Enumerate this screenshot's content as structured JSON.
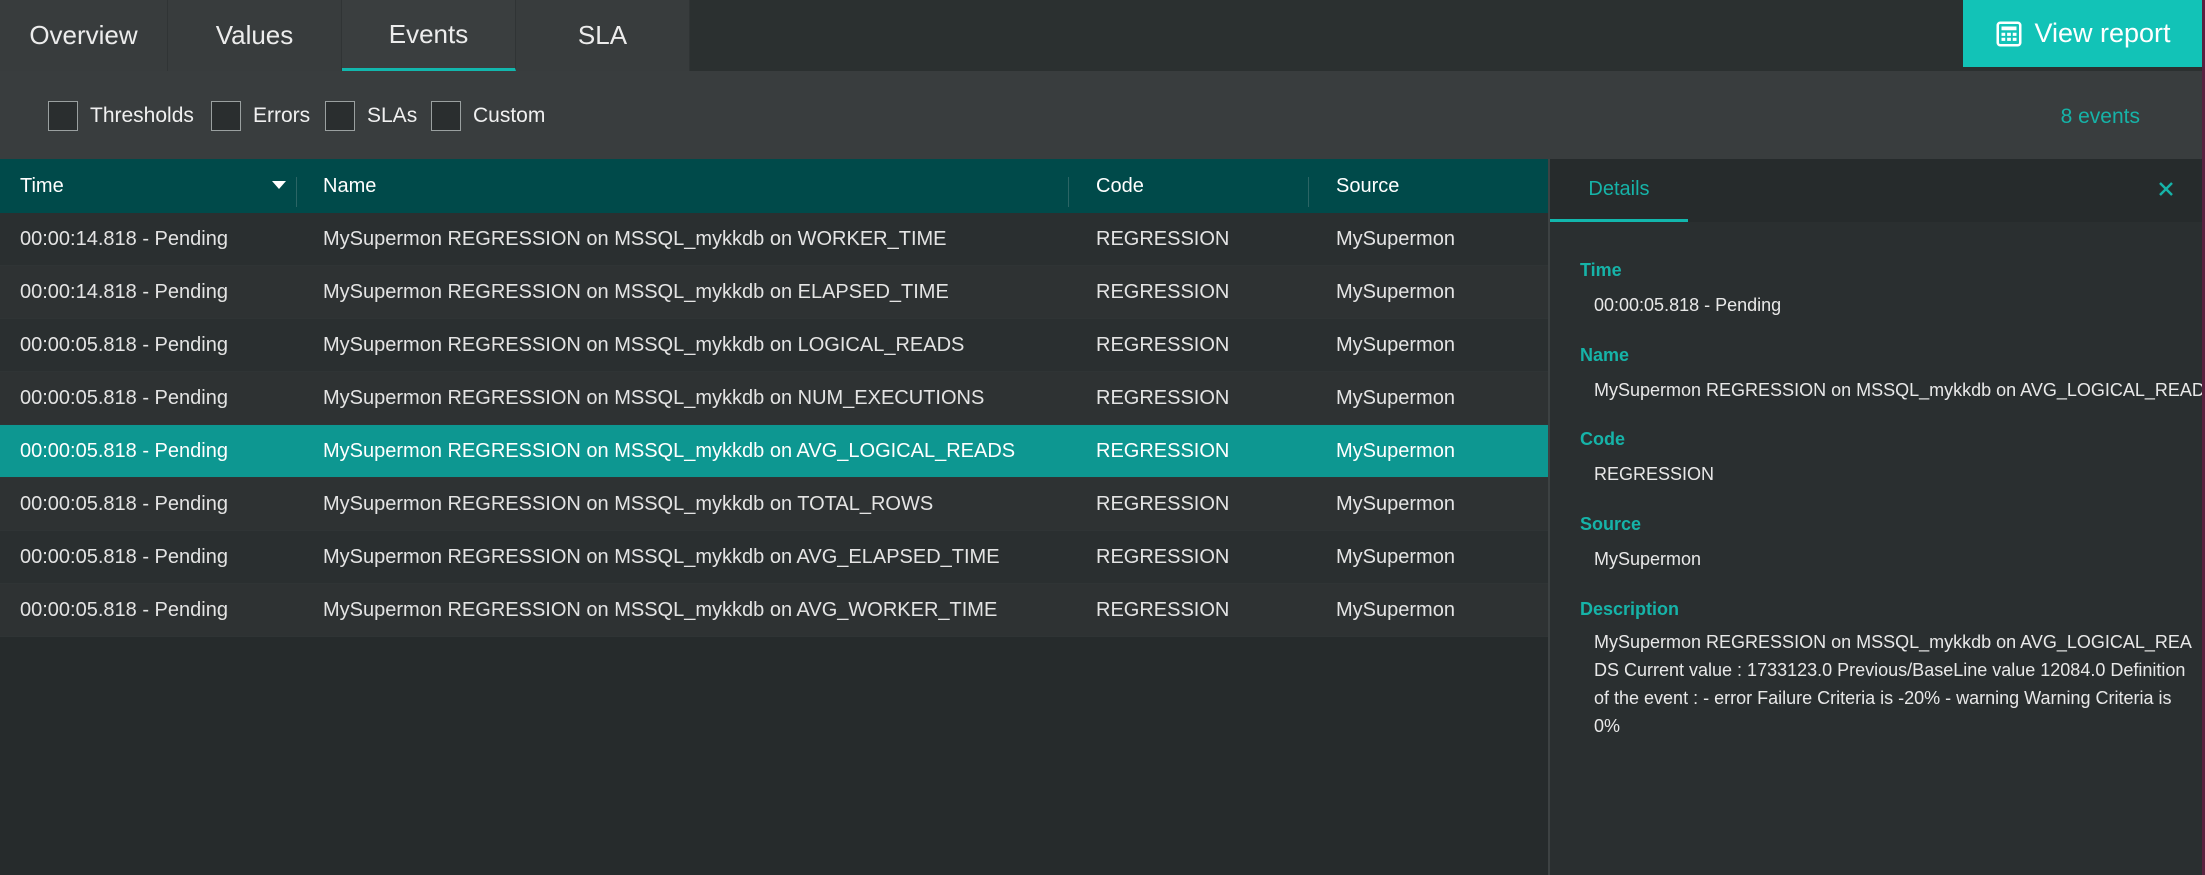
{
  "tabs": [
    {
      "label": "Overview"
    },
    {
      "label": "Values"
    },
    {
      "label": "Events"
    },
    {
      "label": "SLA"
    }
  ],
  "view_report": {
    "label": "View report",
    "icon": "report-icon"
  },
  "filters": [
    {
      "label": "Thresholds",
      "checked": false
    },
    {
      "label": "Errors",
      "checked": false
    },
    {
      "label": "SLAs",
      "checked": false
    },
    {
      "label": "Custom",
      "checked": false
    }
  ],
  "events_count": "8 events",
  "table": {
    "columns": [
      "Time",
      "Name",
      "Code",
      "Source"
    ],
    "rows": [
      {
        "time": "00:00:14.818 - Pending",
        "name": "MySupermon REGRESSION on MSSQL_mykkdb on WORKER_TIME",
        "code": "REGRESSION",
        "source": "MySupermon"
      },
      {
        "time": "00:00:14.818 - Pending",
        "name": "MySupermon REGRESSION on MSSQL_mykkdb on ELAPSED_TIME",
        "code": "REGRESSION",
        "source": "MySupermon"
      },
      {
        "time": "00:00:05.818 - Pending",
        "name": "MySupermon REGRESSION on MSSQL_mykkdb on LOGICAL_READS",
        "code": "REGRESSION",
        "source": "MySupermon"
      },
      {
        "time": "00:00:05.818 - Pending",
        "name": "MySupermon REGRESSION on MSSQL_mykkdb on NUM_EXECUTIONS",
        "code": "REGRESSION",
        "source": "MySupermon"
      },
      {
        "time": "00:00:05.818 - Pending",
        "name": "MySupermon REGRESSION on MSSQL_mykkdb on AVG_LOGICAL_READS",
        "code": "REGRESSION",
        "source": "MySupermon"
      },
      {
        "time": "00:00:05.818 - Pending",
        "name": "MySupermon REGRESSION on MSSQL_mykkdb on TOTAL_ROWS",
        "code": "REGRESSION",
        "source": "MySupermon"
      },
      {
        "time": "00:00:05.818 - Pending",
        "name": "MySupermon REGRESSION on MSSQL_mykkdb on AVG_ELAPSED_TIME",
        "code": "REGRESSION",
        "source": "MySupermon"
      },
      {
        "time": "00:00:05.818 - Pending",
        "name": "MySupermon REGRESSION on MSSQL_mykkdb on AVG_WORKER_TIME",
        "code": "REGRESSION",
        "source": "MySupermon"
      }
    ]
  },
  "details": {
    "tab_label": "Details",
    "fields": [
      {
        "label": "Time",
        "value": "00:00:05.818 - Pending"
      },
      {
        "label": "Name",
        "value": "MySupermon REGRESSION on MSSQL_mykkdb on AVG_LOGICAL_READS"
      },
      {
        "label": "Code",
        "value": "REGRESSION"
      },
      {
        "label": "Source",
        "value": "MySupermon"
      },
      {
        "label": "Description",
        "value": "MySupermon REGRESSION on MSSQL_mykkdb on AVG_LOGICAL_READS Current value : 1733123.0 Previous/BaseLine value 12084.0 Definition of the event : - error Failure Criteria is -20% - warning Warning Criteria is 0%"
      }
    ]
  },
  "colors": {
    "accent": "#12c3b7",
    "header_bg": "#004a4a",
    "selected_row": "#0d9791",
    "background": "#262b2c"
  }
}
